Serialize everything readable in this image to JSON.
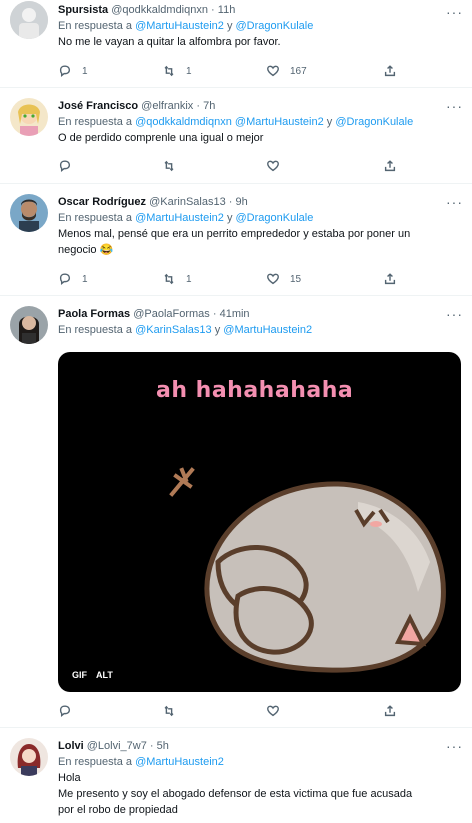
{
  "tweets": [
    {
      "name": "Spursista",
      "handle": "@qodkkaldmdiqnxn",
      "time": "11h",
      "reply_prefix": "En respuesta a",
      "reply_to_1": "@MartuHaustein2",
      "reply_conj": "y",
      "reply_to_2": "@DragonKulale",
      "text": "No me le vayan a quitar la alfombra por favor.",
      "replies": "1",
      "retweets": "1",
      "likes": "167"
    },
    {
      "name": "José Francisco",
      "handle": "@elfrankix",
      "time": "7h",
      "reply_prefix": "En respuesta a",
      "reply_to_1": "@qodkkaldmdiqnxn",
      "reply_to_2": "@MartuHaustein2",
      "reply_conj": "y",
      "reply_to_3": "@DragonKulale",
      "text": "O de perdido comprenle una igual o mejor",
      "replies": "",
      "retweets": "",
      "likes": ""
    },
    {
      "name": "Oscar Rodríguez",
      "handle": "@KarinSalas13",
      "time": "9h",
      "reply_prefix": "En respuesta a",
      "reply_to_1": "@MartuHaustein2",
      "reply_conj": "y",
      "reply_to_2": "@DragonKulale",
      "text_1": "Menos mal, pensé que era un perrito emprededor y estaba por poner un",
      "text_2": "negocio 😂",
      "replies": "1",
      "retweets": "1",
      "likes": "15"
    },
    {
      "name": "Paola Formas",
      "handle": "@PaolaFormas",
      "time": "41min",
      "reply_prefix": "En respuesta a",
      "reply_to_1": "@KarinSalas13",
      "reply_conj": "y",
      "reply_to_2": "@MartuHaustein2",
      "gif_caption": "ah hahahahaha",
      "gif_badge": "GIF",
      "alt_badge": "ALT",
      "replies": "",
      "retweets": "",
      "likes": ""
    },
    {
      "name": "Lolvi",
      "handle": "@Lolvi_7w7",
      "time": "5h",
      "reply_prefix": "En respuesta a",
      "reply_to_1": "@MartuHaustein2",
      "text_1": "Hola",
      "text_2": "Me presento y soy el abogado defensor de esta victima que fue acusada",
      "text_3": "por el robo de propiedad"
    }
  ],
  "separator": "·",
  "colors": {
    "link": "#1d9bf0",
    "muted": "#536471",
    "text": "#0f1419",
    "border": "#eff3f4"
  },
  "icons": [
    "reply-icon",
    "retweet-icon",
    "like-icon",
    "share-icon",
    "more-icon"
  ]
}
